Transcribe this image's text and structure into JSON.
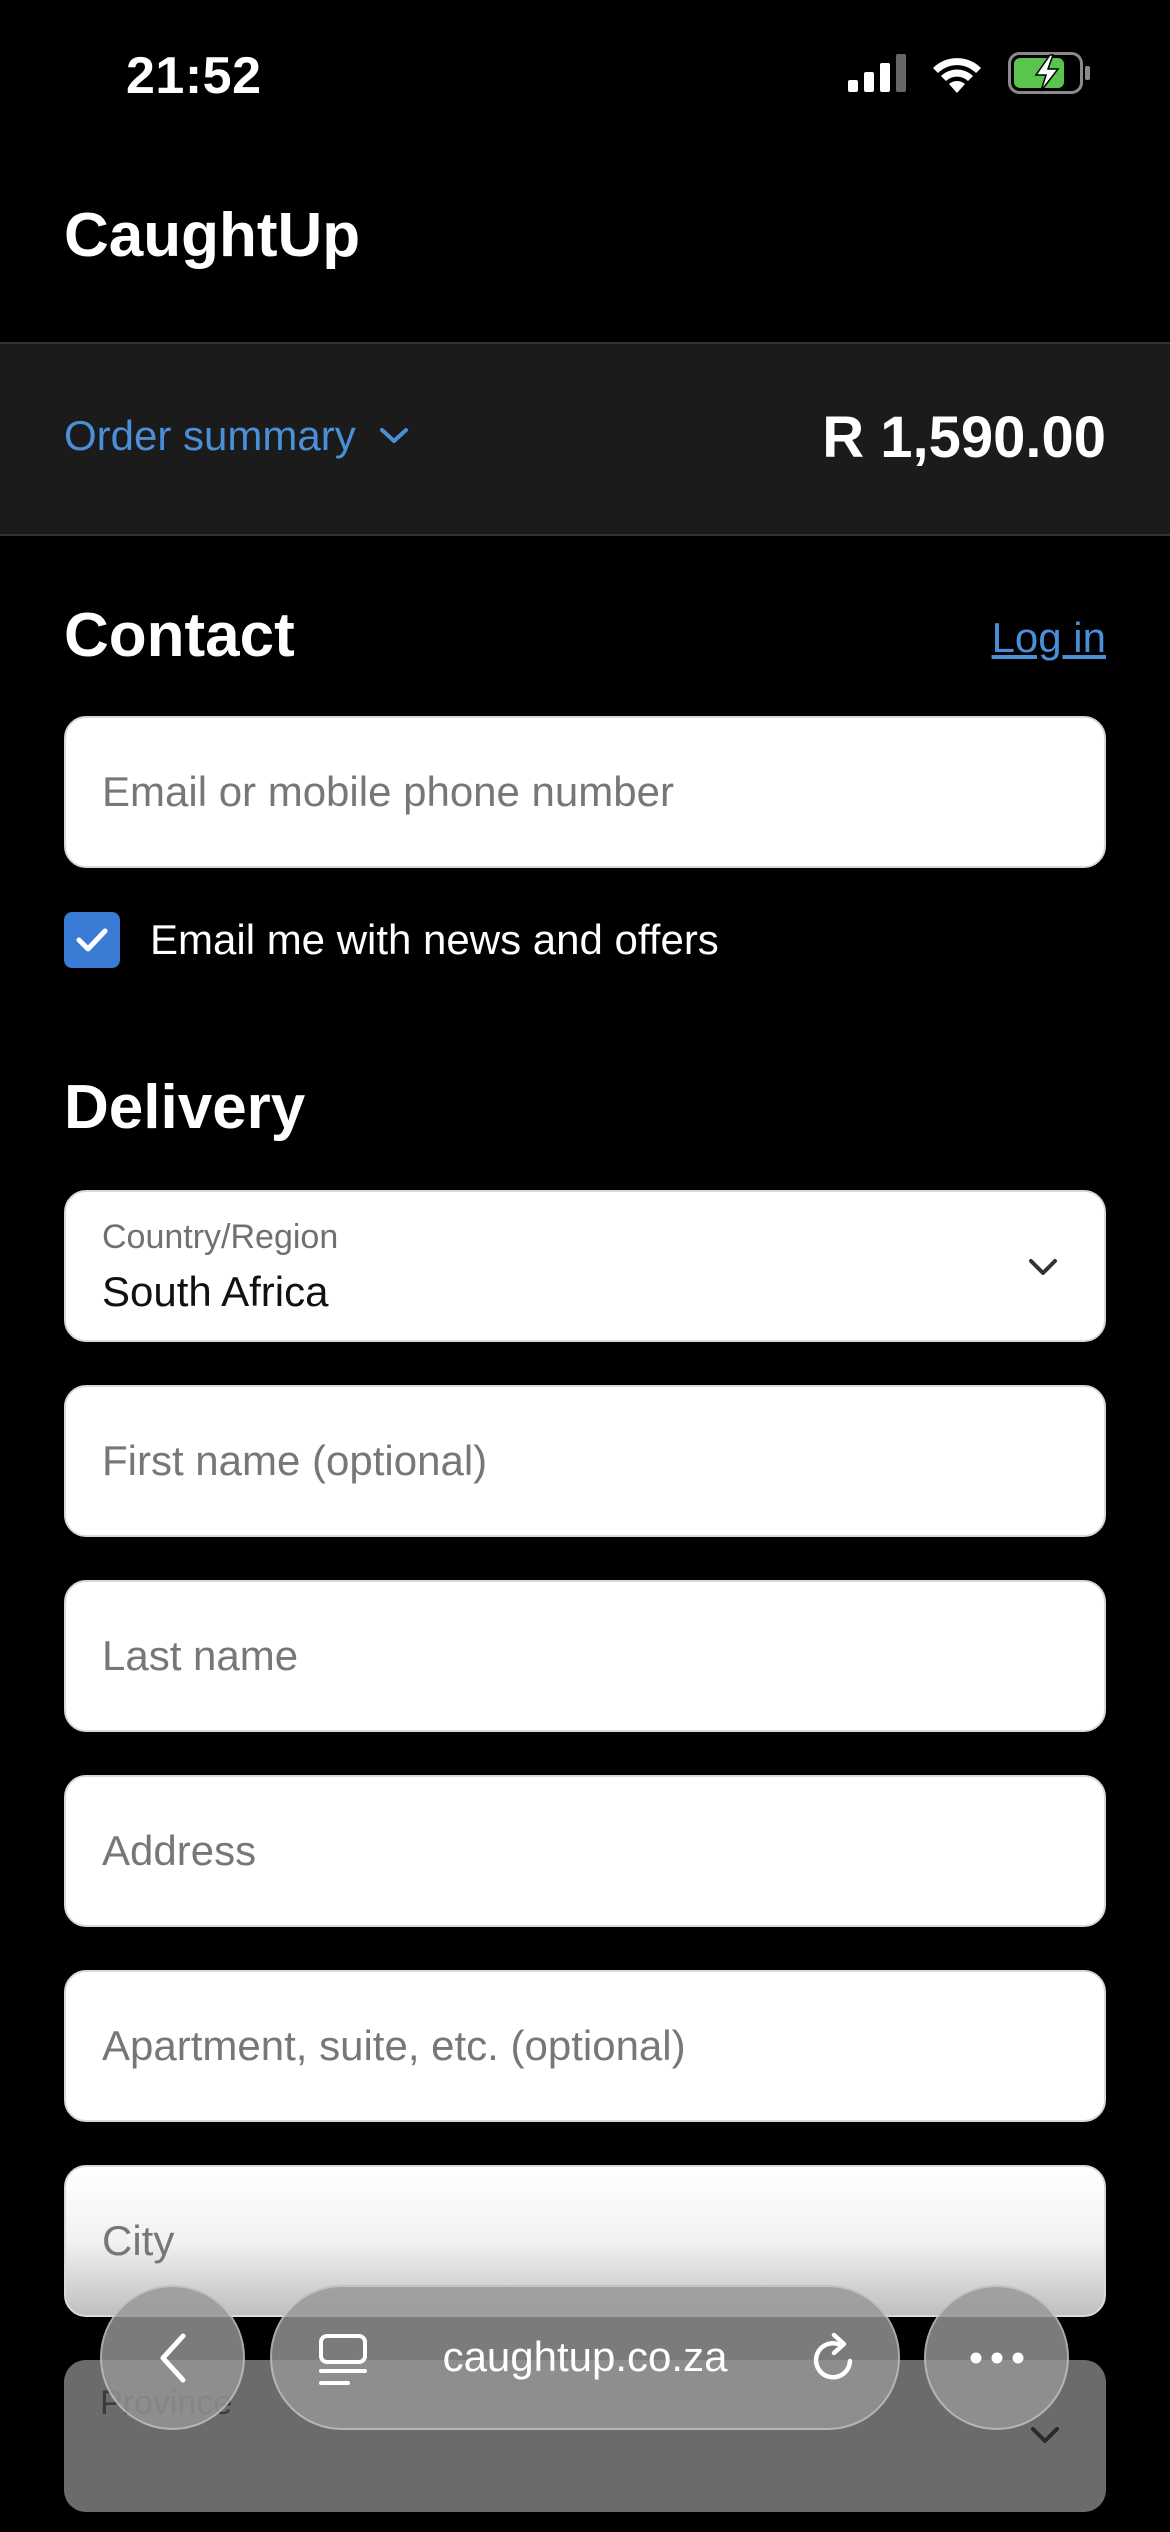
{
  "status": {
    "time": "21:52"
  },
  "header": {
    "brand": "CaughtUp"
  },
  "summary": {
    "toggle_label": "Order summary",
    "total": "R 1,590.00"
  },
  "contact": {
    "title": "Contact",
    "login_label": "Log in",
    "email_placeholder": "Email or mobile phone number",
    "newsletter_label": "Email me with news and offers",
    "newsletter_checked": true
  },
  "delivery": {
    "title": "Delivery",
    "country_label": "Country/Region",
    "country_value": "South Africa",
    "first_name_placeholder": "First name (optional)",
    "last_name_placeholder": "Last name",
    "address_placeholder": "Address",
    "apartment_placeholder": "Apartment, suite, etc. (optional)",
    "city_placeholder": "City",
    "province_label": "Province"
  },
  "browser": {
    "url": "caughtup.co.za"
  },
  "colors": {
    "accent": "#4a8fd8",
    "checkbox": "#3a7bd5",
    "summary_bg": "#1b1b1b",
    "battery": "#5ac54d"
  },
  "icons": [
    "cellular-signal-icon",
    "wifi-icon",
    "battery-charging-icon",
    "chevron-down-icon",
    "checkmark-icon",
    "back-chevron-icon",
    "tabs-icon",
    "reload-icon",
    "more-icon"
  ]
}
